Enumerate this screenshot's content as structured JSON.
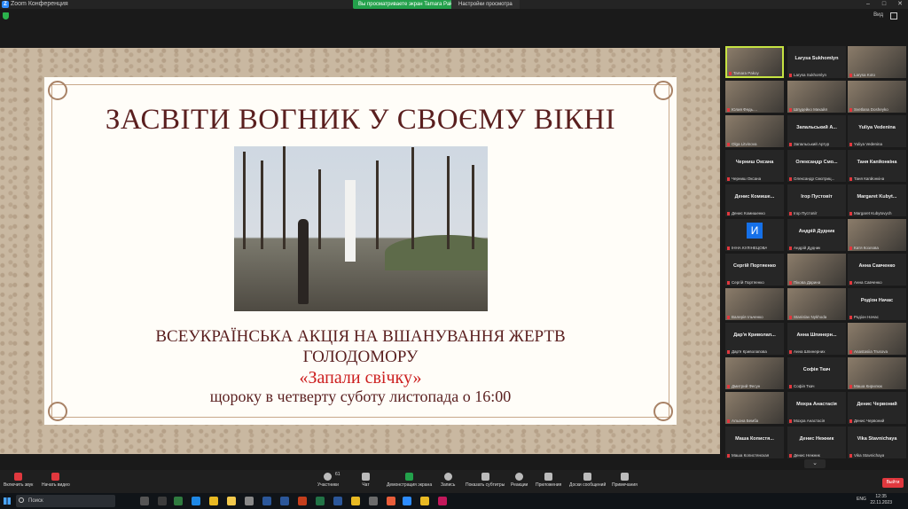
{
  "window": {
    "title": "Zoom Конференция",
    "share_banner": "Вы просматриваете экран Tamara Pakoy",
    "view_options": "Настройки просмотра",
    "view_label": "Вид"
  },
  "slide": {
    "title": "ЗАСВІТИ ВОГНИК У СВОЄМУ ВІКНІ",
    "line1": "ВСЕУКРАЇНСЬКА АКЦІЯ НА ВШАНУВАННЯ ЖЕРТВ",
    "line2": "ГОЛОДОМОРУ",
    "line3": "«Запали свічку»",
    "line4": "щороку в четверту суботу листопада о 16:00"
  },
  "participants": [
    {
      "center": "",
      "bottom": "Tamara Pakoy",
      "video": true,
      "active": true
    },
    {
      "center": "Larysa Sukhomlyn",
      "bottom": "Larysa Sukhomlyn",
      "video": false
    },
    {
      "center": "",
      "bottom": "Larysa Koto",
      "video": true
    },
    {
      "center": "",
      "bottom": "Юлия Федь....",
      "video": true
    },
    {
      "center": "",
      "bottom": "Шпудейко Михайл",
      "video": true
    },
    {
      "center": "",
      "bottom": "Svetlana Dosheyko",
      "video": true
    },
    {
      "center": "",
      "bottom": "Olga Litvinova",
      "video": true
    },
    {
      "center": "Запальський А...",
      "bottom": "Запальський Артур",
      "video": false
    },
    {
      "center": "Yuliya Vedenina",
      "bottom": "Yuliya Vedenina",
      "video": false
    },
    {
      "center": "Черниш Оксана",
      "bottom": "Черниш Оксана",
      "video": false
    },
    {
      "center": "Олександр Смо...",
      "bottom": "Олександр Смотриц...",
      "video": false
    },
    {
      "center": "Таня Капйонкіна",
      "bottom": "Таня Капйонкіна",
      "video": false
    },
    {
      "center": "Денис Комише...",
      "bottom": "Денис Комишенко",
      "video": false
    },
    {
      "center": "Ігор Пустовіт",
      "bottom": "Ігор Пустовіт",
      "video": false
    },
    {
      "center": "Margaret Kubyt...",
      "bottom": "Margaret Kubytovych",
      "video": false
    },
    {
      "center": "",
      "bottom": "ІННА КУЛІНЕЦОВА",
      "video": false,
      "avatar": "И"
    },
    {
      "center": "Андрій Дудник",
      "bottom": "Андрій Дудник",
      "video": false
    },
    {
      "center": "",
      "bottom": "Катя Козлова",
      "video": true
    },
    {
      "center": "Сергій Портяенко",
      "bottom": "Сергій Портяенко",
      "video": false
    },
    {
      "center": "",
      "bottom": "Пікова Дарина",
      "video": true
    },
    {
      "center": "Анна Савченко",
      "bottom": "Анна Савченко",
      "video": false
    },
    {
      "center": "",
      "bottom": "Валерія Ільченко",
      "video": true
    },
    {
      "center": "",
      "bottom": "Stanislav Nykhoda",
      "video": true
    },
    {
      "center": "Родіон Начас",
      "bottom": "Родіон Начас",
      "video": false
    },
    {
      "center": "Дар'я Криволап...",
      "bottom": "Дар'я Криволапова",
      "video": false
    },
    {
      "center": "Анна Шпинерн...",
      "bottom": "Анна Шпинерних",
      "video": false
    },
    {
      "center": "",
      "bottom": "Anastasiia Trusova",
      "video": true
    },
    {
      "center": "",
      "bottom": "Дмитрий Фесун",
      "video": true
    },
    {
      "center": "Софія Ткач",
      "bottom": "Софія Ткач",
      "video": false
    },
    {
      "center": "",
      "bottom": "Маша Кирилюк",
      "video": true
    },
    {
      "center": "",
      "bottom": "Альона Бемба",
      "video": true
    },
    {
      "center": "Мохра Анастасія",
      "bottom": "Мохра Анастасія",
      "video": false
    },
    {
      "center": "Денис Червоний",
      "bottom": "Денис Червоний",
      "video": false
    },
    {
      "center": "Маша Копистя...",
      "bottom": "Маша Копистянская",
      "video": false
    },
    {
      "center": "Денис Нежник",
      "bottom": "Денис Нежник",
      "video": false
    },
    {
      "center": "Vika Stavnichaya",
      "bottom": "Vika Stavnichaya",
      "video": false
    }
  ],
  "toolbar": {
    "mic_label": "Включить звук",
    "video_label": "Начать видео",
    "participants_label": "Участники",
    "participants_count": "61",
    "chat_label": "Чат",
    "share_label": "Демонстрация экрана",
    "record_label": "Запись",
    "subtitles_label": "Показать субтитры",
    "reactions_label": "Реакции",
    "apps_label": "Приложения",
    "whiteboard_label": "Доски сообщений",
    "notes_label": "Примечания",
    "leave_label": "Выйти"
  },
  "taskbar": {
    "search_placeholder": "Поиск",
    "lang": "ENG",
    "time": "12:35",
    "date": "22.11.2023"
  }
}
